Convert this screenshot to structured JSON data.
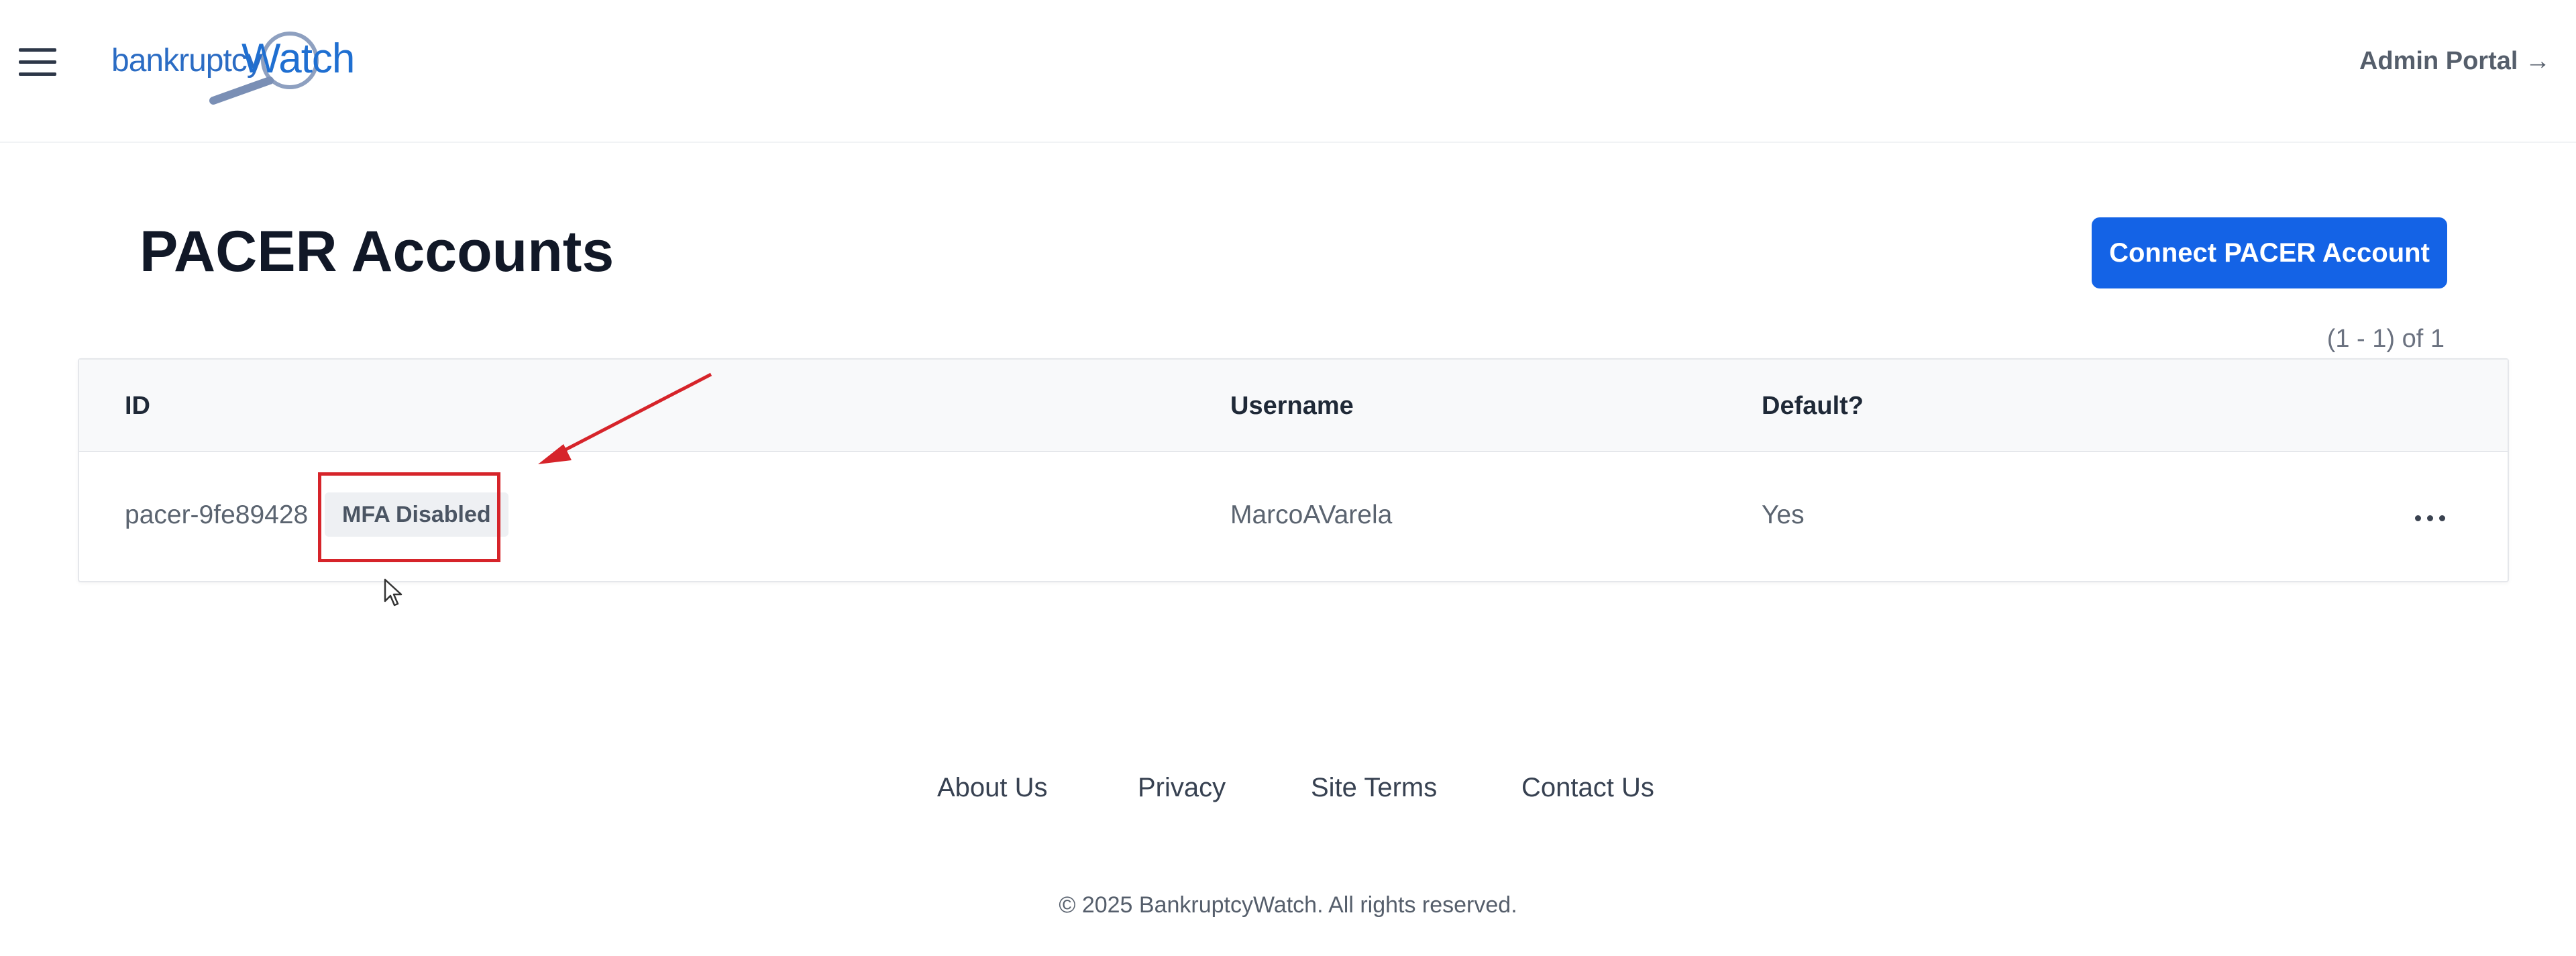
{
  "header": {
    "logo_text_part1": "bankruptcy",
    "logo_text_part2": "Watch",
    "admin_link": "Admin Portal →"
  },
  "main": {
    "title": "PACER Accounts",
    "connect_button": "Connect PACER Account",
    "pagination": "(1 - 1) of 1"
  },
  "table": {
    "headers": {
      "id": "ID",
      "username": "Username",
      "default": "Default?"
    },
    "rows": [
      {
        "id": "pacer-9fe89428",
        "badge": "MFA Disabled",
        "username": "MarcoAVarela",
        "default": "Yes"
      }
    ]
  },
  "footer": {
    "links": [
      "About Us",
      "Privacy",
      "Site Terms",
      "Contact Us"
    ],
    "copyright": "© 2025 BankruptcyWatch. All rights reserved."
  },
  "colors": {
    "primary": "#1463e6",
    "annotation": "#d6242a",
    "logo": "#1f6fd1"
  },
  "icons": [
    "menu-icon",
    "ellipsis-icon",
    "magnifier-icon",
    "cursor-icon",
    "arrow-annotation"
  ]
}
